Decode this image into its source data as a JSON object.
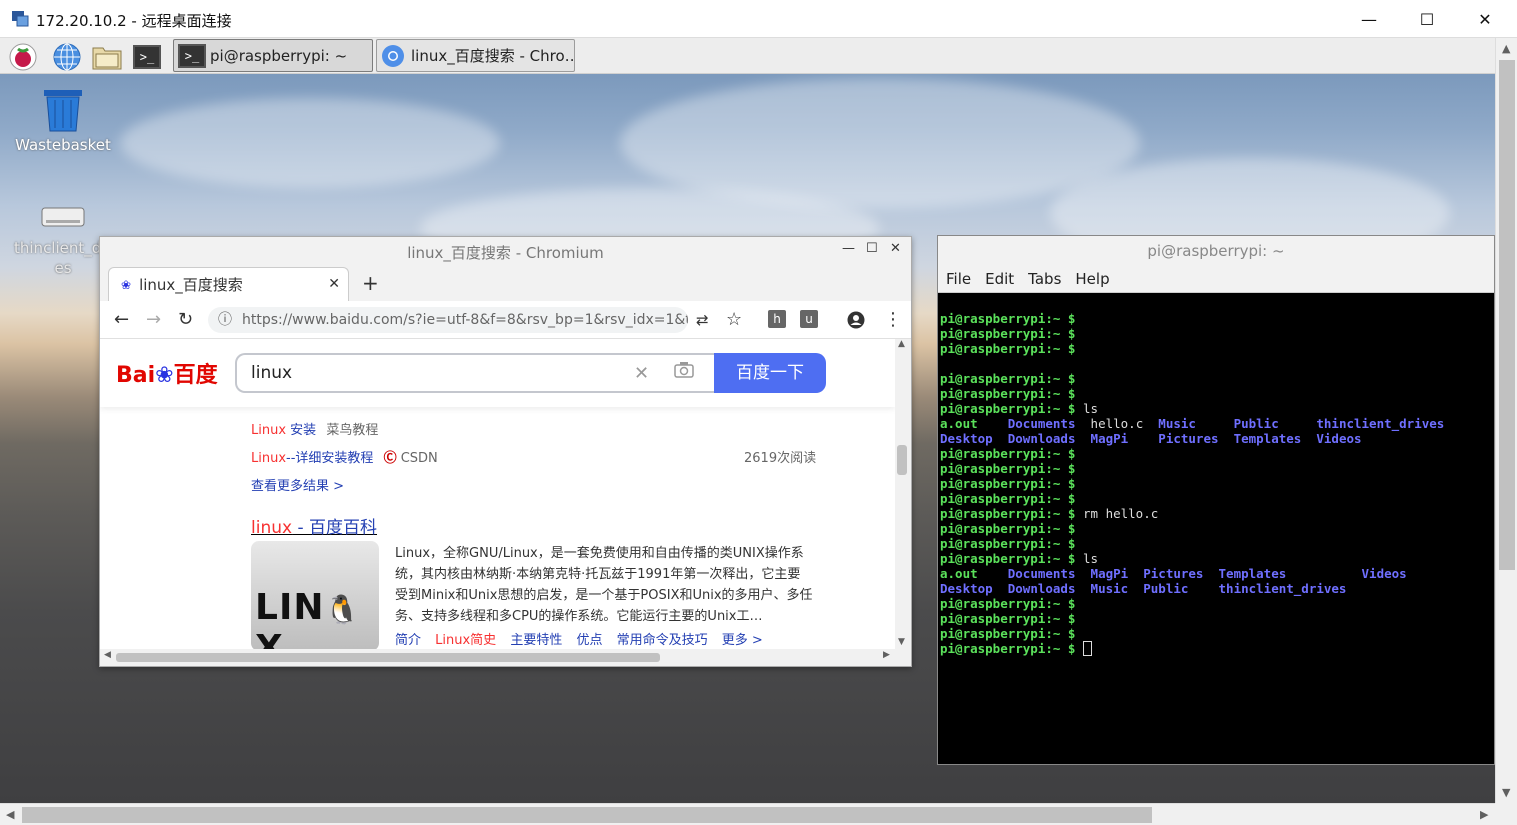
{
  "rdp": {
    "title": "172.20.10.2 - 远程桌面连接",
    "min": "—",
    "max": "☐",
    "close": "✕"
  },
  "panel": {
    "tasks": [
      {
        "label": "pi@raspberrypi: ~"
      },
      {
        "label": "linux_百度搜索 - Chro…"
      }
    ]
  },
  "desktop_icons": [
    {
      "label": "Wastebasket"
    },
    {
      "label": "thinclient_driv es"
    }
  ],
  "chromium": {
    "window_title": "linux_百度搜索 - Chromium",
    "tab_label": "linux_百度搜索",
    "url": "https://www.baidu.com/s?ie=utf-8&f=8&rsv_bp=1&rsv_idx=1&tn=bai…",
    "ext_h": "h",
    "ext_u": "u",
    "page": {
      "logo_bai": "Bai",
      "logo_du": "百度",
      "query": "linux",
      "search_button": "百度一下",
      "r1_title_red": "Linux",
      "r1_title_rest": " 安装",
      "r1_source": "菜鸟教程",
      "r2_title_red": "Linux",
      "r2_title_rest": "--详细安装教程",
      "r2_source": "CSDN",
      "r2_reads": "2619次阅读",
      "more_results": "查看更多结果 >",
      "baike_title_red": "linux",
      "baike_title_rest": " - 百度百科",
      "baike_abstract": "Linux，全称GNU/Linux，是一套免费使用和自由传播的类UNIX操作系统，其内核由林纳斯·本纳第克特·托瓦兹于1991年第一次释出，它主要受到Minix和Unix思想的启发，是一个基于POSIX和Unix的多用户、多任务、支持多线程和多CPU的操作系统。它能运行主要的Unix工…",
      "baike_links": [
        "简介",
        "Linux简史",
        "主要特性",
        "优点",
        "常用命令及技巧",
        "更多 >"
      ]
    }
  },
  "terminal": {
    "window_title": "pi@raspberrypi: ~",
    "menu": [
      "File",
      "Edit",
      "Tabs",
      "Help"
    ],
    "prompt": "pi@raspberrypi:~ $",
    "cmd_ls": "ls",
    "cmd_rm": "rm hello.c",
    "ls1_row1": [
      "a.out",
      "Documents",
      "hello.c",
      "Music",
      "Public",
      "thinclient_drives"
    ],
    "ls1_row2": [
      "Desktop",
      "Downloads",
      "MagPi",
      "Pictures",
      "Templates",
      "Videos"
    ],
    "ls2_row1": [
      "a.out",
      "Documents",
      "MagPi",
      "Pictures",
      "Templates",
      "Videos"
    ],
    "ls2_row2": [
      "Desktop",
      "Downloads",
      "Music",
      "Public",
      "thinclient_drives"
    ]
  }
}
